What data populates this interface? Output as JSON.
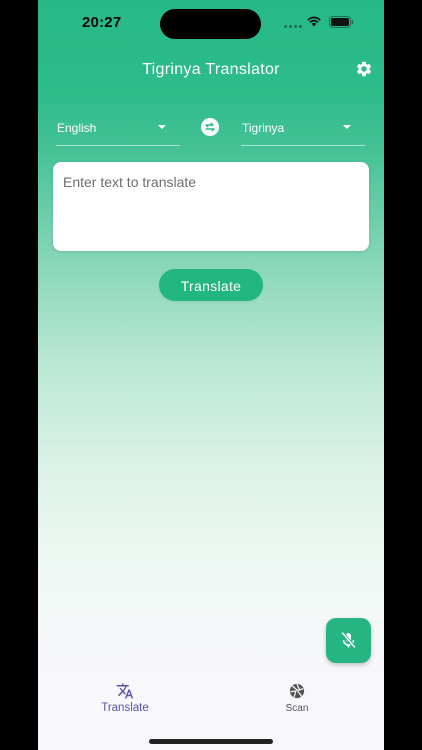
{
  "status_bar": {
    "time": "20:27",
    "icons": [
      "signal-dots-icon",
      "wifi-icon",
      "battery-icon"
    ]
  },
  "app_bar": {
    "title": "Tigrinya Translator",
    "settings_icon": "gear-icon"
  },
  "languages": {
    "source": "English",
    "target": "Tigrinya",
    "swap_icon": "swap-arrows-icon"
  },
  "input": {
    "value": "",
    "placeholder": "Enter text to translate"
  },
  "actions": {
    "translate_label": "Translate",
    "mic_icon": "mic-off-icon"
  },
  "bottom_nav": {
    "items": [
      {
        "label": "Translate",
        "icon": "translate-icon",
        "active": true
      },
      {
        "label": "Scan",
        "icon": "camera-aperture-icon",
        "active": false
      }
    ]
  },
  "colors": {
    "primary": "#26b987",
    "button": "#22b680",
    "active_nav": "#5a55a8",
    "background_bottom": "#f7f6fb"
  }
}
